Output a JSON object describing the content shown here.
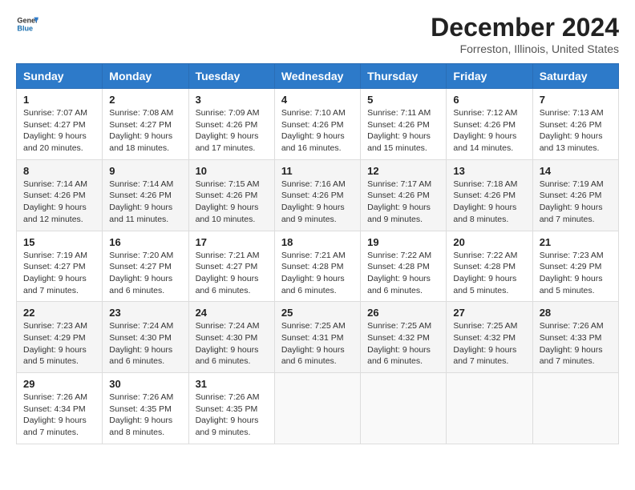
{
  "header": {
    "logo_line1": "General",
    "logo_line2": "Blue",
    "month_title": "December 2024",
    "location": "Forreston, Illinois, United States"
  },
  "weekdays": [
    "Sunday",
    "Monday",
    "Tuesday",
    "Wednesday",
    "Thursday",
    "Friday",
    "Saturday"
  ],
  "weeks": [
    [
      {
        "day": "1",
        "sunrise": "7:07 AM",
        "sunset": "4:27 PM",
        "daylight": "9 hours and 20 minutes."
      },
      {
        "day": "2",
        "sunrise": "7:08 AM",
        "sunset": "4:27 PM",
        "daylight": "9 hours and 18 minutes."
      },
      {
        "day": "3",
        "sunrise": "7:09 AM",
        "sunset": "4:26 PM",
        "daylight": "9 hours and 17 minutes."
      },
      {
        "day": "4",
        "sunrise": "7:10 AM",
        "sunset": "4:26 PM",
        "daylight": "9 hours and 16 minutes."
      },
      {
        "day": "5",
        "sunrise": "7:11 AM",
        "sunset": "4:26 PM",
        "daylight": "9 hours and 15 minutes."
      },
      {
        "day": "6",
        "sunrise": "7:12 AM",
        "sunset": "4:26 PM",
        "daylight": "9 hours and 14 minutes."
      },
      {
        "day": "7",
        "sunrise": "7:13 AM",
        "sunset": "4:26 PM",
        "daylight": "9 hours and 13 minutes."
      }
    ],
    [
      {
        "day": "8",
        "sunrise": "7:14 AM",
        "sunset": "4:26 PM",
        "daylight": "9 hours and 12 minutes."
      },
      {
        "day": "9",
        "sunrise": "7:14 AM",
        "sunset": "4:26 PM",
        "daylight": "9 hours and 11 minutes."
      },
      {
        "day": "10",
        "sunrise": "7:15 AM",
        "sunset": "4:26 PM",
        "daylight": "9 hours and 10 minutes."
      },
      {
        "day": "11",
        "sunrise": "7:16 AM",
        "sunset": "4:26 PM",
        "daylight": "9 hours and 9 minutes."
      },
      {
        "day": "12",
        "sunrise": "7:17 AM",
        "sunset": "4:26 PM",
        "daylight": "9 hours and 9 minutes."
      },
      {
        "day": "13",
        "sunrise": "7:18 AM",
        "sunset": "4:26 PM",
        "daylight": "9 hours and 8 minutes."
      },
      {
        "day": "14",
        "sunrise": "7:19 AM",
        "sunset": "4:26 PM",
        "daylight": "9 hours and 7 minutes."
      }
    ],
    [
      {
        "day": "15",
        "sunrise": "7:19 AM",
        "sunset": "4:27 PM",
        "daylight": "9 hours and 7 minutes."
      },
      {
        "day": "16",
        "sunrise": "7:20 AM",
        "sunset": "4:27 PM",
        "daylight": "9 hours and 6 minutes."
      },
      {
        "day": "17",
        "sunrise": "7:21 AM",
        "sunset": "4:27 PM",
        "daylight": "9 hours and 6 minutes."
      },
      {
        "day": "18",
        "sunrise": "7:21 AM",
        "sunset": "4:28 PM",
        "daylight": "9 hours and 6 minutes."
      },
      {
        "day": "19",
        "sunrise": "7:22 AM",
        "sunset": "4:28 PM",
        "daylight": "9 hours and 6 minutes."
      },
      {
        "day": "20",
        "sunrise": "7:22 AM",
        "sunset": "4:28 PM",
        "daylight": "9 hours and 5 minutes."
      },
      {
        "day": "21",
        "sunrise": "7:23 AM",
        "sunset": "4:29 PM",
        "daylight": "9 hours and 5 minutes."
      }
    ],
    [
      {
        "day": "22",
        "sunrise": "7:23 AM",
        "sunset": "4:29 PM",
        "daylight": "9 hours and 5 minutes."
      },
      {
        "day": "23",
        "sunrise": "7:24 AM",
        "sunset": "4:30 PM",
        "daylight": "9 hours and 6 minutes."
      },
      {
        "day": "24",
        "sunrise": "7:24 AM",
        "sunset": "4:30 PM",
        "daylight": "9 hours and 6 minutes."
      },
      {
        "day": "25",
        "sunrise": "7:25 AM",
        "sunset": "4:31 PM",
        "daylight": "9 hours and 6 minutes."
      },
      {
        "day": "26",
        "sunrise": "7:25 AM",
        "sunset": "4:32 PM",
        "daylight": "9 hours and 6 minutes."
      },
      {
        "day": "27",
        "sunrise": "7:25 AM",
        "sunset": "4:32 PM",
        "daylight": "9 hours and 7 minutes."
      },
      {
        "day": "28",
        "sunrise": "7:26 AM",
        "sunset": "4:33 PM",
        "daylight": "9 hours and 7 minutes."
      }
    ],
    [
      {
        "day": "29",
        "sunrise": "7:26 AM",
        "sunset": "4:34 PM",
        "daylight": "9 hours and 7 minutes."
      },
      {
        "day": "30",
        "sunrise": "7:26 AM",
        "sunset": "4:35 PM",
        "daylight": "9 hours and 8 minutes."
      },
      {
        "day": "31",
        "sunrise": "7:26 AM",
        "sunset": "4:35 PM",
        "daylight": "9 hours and 9 minutes."
      },
      null,
      null,
      null,
      null
    ]
  ],
  "labels": {
    "sunrise": "Sunrise:",
    "sunset": "Sunset:",
    "daylight": "Daylight:"
  }
}
